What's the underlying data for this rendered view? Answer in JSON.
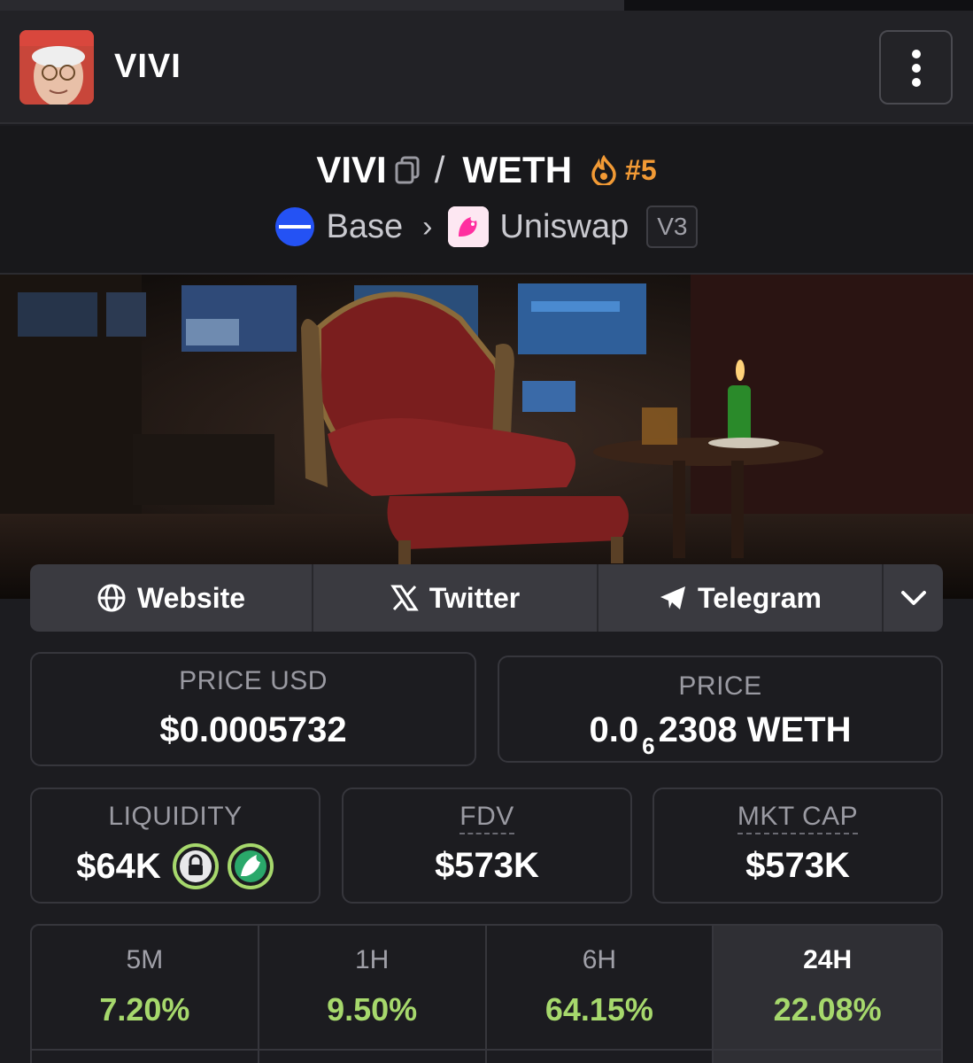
{
  "header": {
    "token_name": "VIVI"
  },
  "pair": {
    "base": "VIVI",
    "separator": "/",
    "quote": "WETH",
    "rank": "#5",
    "chain": "Base",
    "dex": "Uniswap",
    "version": "V3"
  },
  "links": {
    "website": "Website",
    "twitter": "Twitter",
    "telegram": "Telegram"
  },
  "stats": {
    "price_usd_label": "PRICE USD",
    "price_usd": "$0.0005732",
    "price_label": "PRICE",
    "price_prefix": "0.0",
    "price_zero_count": "6",
    "price_suffix": "2308 WETH",
    "liquidity_label": "LIQUIDITY",
    "liquidity": "$64K",
    "fdv_label": "FDV",
    "fdv": "$573K",
    "mktcap_label": "MKT CAP",
    "mktcap": "$573K"
  },
  "timeframes": [
    {
      "label": "5M",
      "value": "7.20%"
    },
    {
      "label": "1H",
      "value": "9.50%"
    },
    {
      "label": "6H",
      "value": "64.15%"
    },
    {
      "label": "24H",
      "value": "22.08%"
    }
  ],
  "colors": {
    "accent_orange": "#f29a35",
    "positive_green": "#a6d86c",
    "base_blue": "#2452f4"
  }
}
